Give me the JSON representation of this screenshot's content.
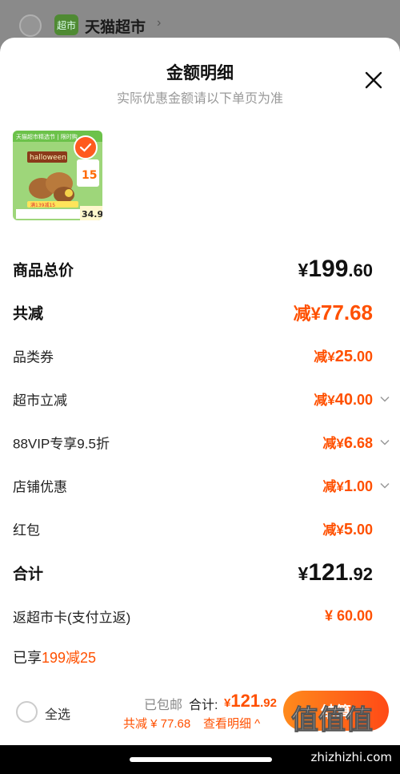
{
  "background": {
    "store_logo": "超市",
    "store_name": "天猫超市",
    "chevron": "›"
  },
  "sheet": {
    "title": "金额明细",
    "subtitle": "实际优惠金额请以下单页为准"
  },
  "product": {
    "banner_top": "天猫超市精选节 | 限时购",
    "brand": "halloween",
    "badge_text": "满139减15",
    "price": "34.9"
  },
  "rows": [
    {
      "label": "商品总价",
      "prefix": "",
      "currency": "¥",
      "int": "199",
      "dec": ".60"
    },
    {
      "label": "共减",
      "prefix": "减",
      "currency": "¥",
      "int": "77",
      "dec": ".68"
    },
    {
      "label": "品类券",
      "prefix": "减",
      "currency": "¥",
      "int": "25",
      "dec": ".00"
    },
    {
      "label": "超市立减",
      "prefix": "减",
      "currency": "¥",
      "int": "40",
      "dec": ".00"
    },
    {
      "label": "88VIP专享9.5折",
      "prefix": "减",
      "currency": "¥",
      "int": "6",
      "dec": ".68"
    },
    {
      "label": "店铺优惠",
      "prefix": "减",
      "currency": "¥",
      "int": "1",
      "dec": ".00"
    },
    {
      "label": "红包",
      "prefix": "减",
      "currency": "¥",
      "int": "5",
      "dec": ".00"
    },
    {
      "label": "合计",
      "prefix": "",
      "currency": "¥",
      "int": "121",
      "dec": ".92"
    },
    {
      "label": "返超市卡(支付立返)",
      "amount": "¥ 60.00"
    }
  ],
  "promo": {
    "prefix": "已享",
    "highlight": "199减25"
  },
  "bottom": {
    "select_all": "全选",
    "shipping": "已包邮",
    "total_label": "合计:",
    "total_currency": "¥",
    "total_int": "121",
    "total_dec": ".92",
    "saved": "共减 ¥ 77.68",
    "view_detail": "查看明细 ^",
    "checkout": "结算"
  },
  "watermark": {
    "text": "值值值",
    "site": "zhizhizhi.com"
  },
  "colors": {
    "accent": "#ff5000",
    "checkout_start": "#ff8a1c",
    "checkout_end": "#ff4a16"
  }
}
